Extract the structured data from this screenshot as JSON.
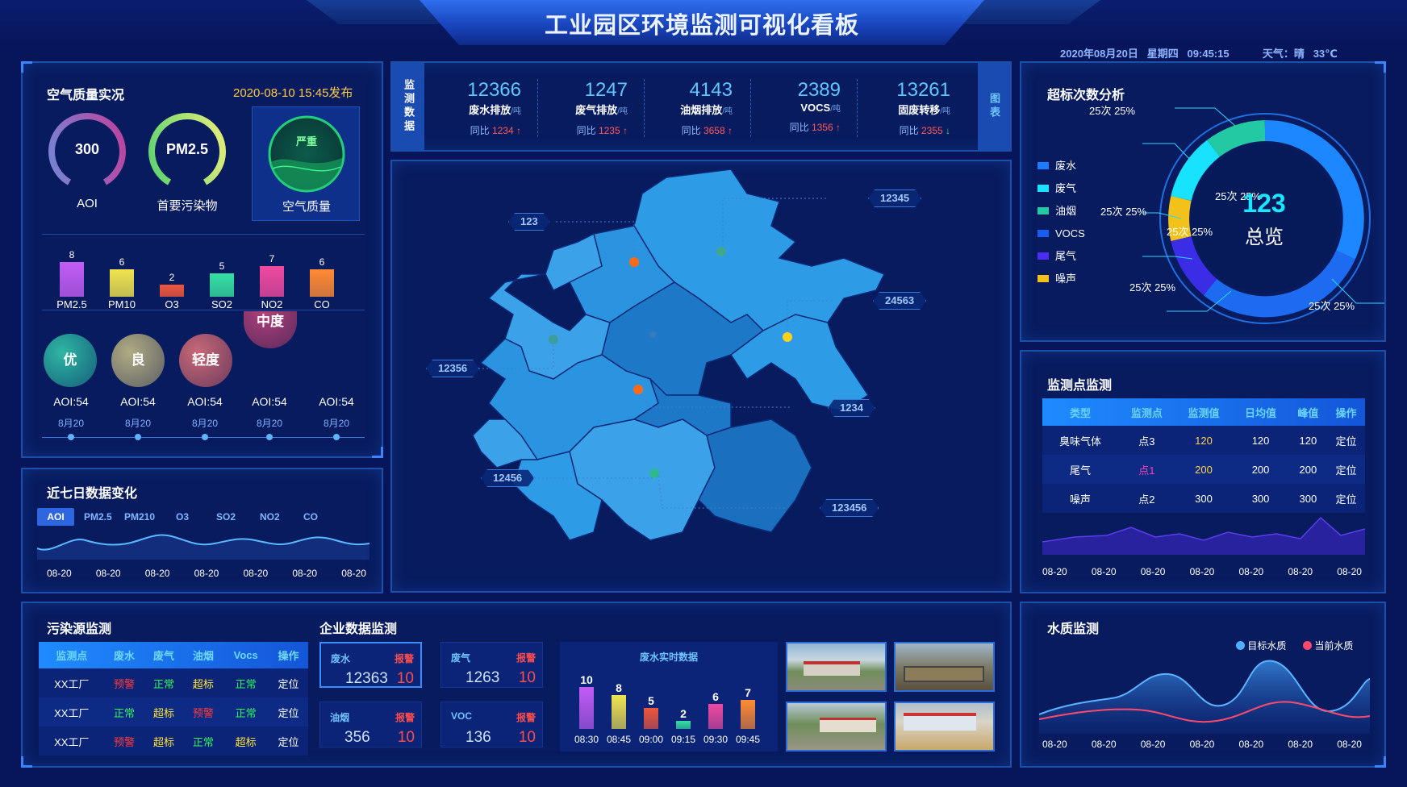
{
  "header": {
    "title": "工业园区环境监测可视化看板",
    "date": "2020年08月20日",
    "weekday": "星期四",
    "time": "09:45:15",
    "weather": "天气：晴",
    "temp": "33℃"
  },
  "air": {
    "title": "空气质量实况",
    "published": "2020-08-10  15:45发布",
    "aqi_value": "300",
    "aqi_label": "AOI",
    "primary_value": "PM2.5",
    "primary_label": "首要污染物",
    "quality_badge": "严重",
    "quality_label": "空气质量",
    "pollutants": [
      {
        "name": "PM2.5",
        "value": 8,
        "color": "#c35cf5"
      },
      {
        "name": "PM10",
        "value": 6,
        "color": "#f0e34e"
      },
      {
        "name": "O3",
        "value": 2,
        "color": "#f0573c"
      },
      {
        "name": "SO2",
        "value": 5,
        "color": "#35e0a2"
      },
      {
        "name": "NO2",
        "value": 7,
        "color": "#f04aa0"
      },
      {
        "name": "CO",
        "value": 6,
        "color": "#ff8a33"
      }
    ],
    "levels": [
      {
        "label": "优",
        "aoi": "AOI:54",
        "date": "8月20"
      },
      {
        "label": "良",
        "aoi": "AOI:54",
        "date": "8月20"
      },
      {
        "label": "轻度",
        "aoi": "AOI:54",
        "date": "8月20"
      },
      {
        "label": "中度",
        "aoi": "AOI:54",
        "date": "8月20"
      },
      {
        "aoi": "AOI:54",
        "date": "8月20"
      }
    ]
  },
  "week": {
    "title": "近七日数据变化",
    "tabs": [
      "AOI",
      "PM2.5",
      "PM210",
      "O3",
      "SO2",
      "NO2",
      "CO"
    ],
    "dates": [
      "08-20",
      "08-20",
      "08-20",
      "08-20",
      "08-20",
      "08-20",
      "08-20"
    ]
  },
  "kpi": {
    "side_label": "监测数据",
    "right_label": "图表",
    "items": [
      {
        "value": "12366",
        "name": "废水排放",
        "unit": "/吨",
        "cmp_label": "同比",
        "cmp_value": "1234",
        "dir": "up"
      },
      {
        "value": "1247",
        "name": "废气排放",
        "unit": "/吨",
        "cmp_label": "同比",
        "cmp_value": "1235",
        "dir": "up"
      },
      {
        "value": "4143",
        "name": "油烟排放",
        "unit": "/吨",
        "cmp_label": "同比",
        "cmp_value": "3658",
        "dir": "up"
      },
      {
        "value": "2389",
        "name": "VOCS",
        "unit": "/吨",
        "cmp_label": "同比",
        "cmp_value": "1356",
        "dir": "up"
      },
      {
        "value": "13261",
        "name": "固废转移",
        "unit": "/吨",
        "cmp_label": "同比",
        "cmp_value": "2355",
        "dir": "down"
      }
    ]
  },
  "map": {
    "tags": [
      "123",
      "12345",
      "24563",
      "12356",
      "1234",
      "12456",
      "123456"
    ]
  },
  "exceed": {
    "title": "超标次数分析",
    "center_value": "123",
    "center_label": "总览",
    "legend": [
      {
        "name": "废水",
        "color": "#1e7bff"
      },
      {
        "name": "废气",
        "color": "#18e3ff"
      },
      {
        "name": "油烟",
        "color": "#22c9a2"
      },
      {
        "name": "VOCS",
        "color": "#1a5cf0"
      },
      {
        "name": "尾气",
        "color": "#4a2df0"
      },
      {
        "name": "噪声",
        "color": "#f2c21b"
      }
    ],
    "slice_labels": [
      "25次 25%",
      "25次 25%",
      "25次 25%",
      "25次 25%",
      "25次 25%",
      "25次 25%"
    ]
  },
  "points": {
    "title": "监测点监测",
    "headers": [
      "类型",
      "监测点",
      "监测值",
      "日均值",
      "峰值",
      "操作"
    ],
    "rows": [
      {
        "type": "臭味气体",
        "point": "点3",
        "value": "120",
        "avg": "120",
        "peak": "120",
        "op": "定位",
        "vcolor": "#ffd24a",
        "pcolor": "#ffffff"
      },
      {
        "type": "尾气",
        "point": "点1",
        "value": "200",
        "avg": "200",
        "peak": "200",
        "op": "定位",
        "vcolor": "#ffd24a",
        "pcolor": "#ff3fb5"
      },
      {
        "type": "噪声",
        "point": "点2",
        "value": "300",
        "avg": "300",
        "peak": "300",
        "op": "定位",
        "vcolor": "#ffffff",
        "pcolor": "#ffffff"
      }
    ],
    "dates": [
      "08-20",
      "08-20",
      "08-20",
      "08-20",
      "08-20",
      "08-20",
      "08-20"
    ]
  },
  "source": {
    "title": "污染源监测",
    "headers": [
      "监测点",
      "废水",
      "废气",
      "油烟",
      "Vocs",
      "操作"
    ],
    "rows": [
      {
        "name": "XX工厂",
        "c": [
          "预警",
          "正常",
          "超标",
          "正常"
        ],
        "cls": [
          "st-red",
          "st-green",
          "st-yellow",
          "st-green"
        ],
        "op": "定位"
      },
      {
        "name": "XX工厂",
        "c": [
          "正常",
          "超标",
          "预警",
          "正常"
        ],
        "cls": [
          "st-green",
          "st-yellow",
          "st-red",
          "st-green"
        ],
        "op": "定位"
      },
      {
        "name": "XX工厂",
        "c": [
          "预警",
          "超标",
          "正常",
          "超标"
        ],
        "cls": [
          "st-red",
          "st-yellow",
          "st-green",
          "st-yellow"
        ],
        "op": "定位"
      }
    ]
  },
  "enterprise": {
    "title": "企业数据监测",
    "boxes": [
      {
        "name": "废水",
        "alarm": "报警",
        "value": "12363",
        "count": "10"
      },
      {
        "name": "废气",
        "alarm": "报警",
        "value": "1263",
        "count": "10"
      },
      {
        "name": "油烟",
        "alarm": "报警",
        "value": "356",
        "count": "10"
      },
      {
        "name": "VOC",
        "alarm": "报警",
        "value": "136",
        "count": "10"
      }
    ],
    "realtime_title": "废水实时数据",
    "realtime": [
      {
        "time": "08:30",
        "value": 10,
        "color": "#c35cf5"
      },
      {
        "time": "08:45",
        "value": 8,
        "color": "#f0e34e"
      },
      {
        "time": "09:00",
        "value": 5,
        "color": "#f0573c"
      },
      {
        "time": "09:15",
        "value": 2,
        "color": "#35e0a2"
      },
      {
        "time": "09:30",
        "value": 6,
        "color": "#f04aa0"
      },
      {
        "time": "09:45",
        "value": 7,
        "color": "#ff8a33"
      }
    ]
  },
  "water": {
    "title": "水质监测",
    "legend": [
      {
        "name": "目标水质",
        "color": "#4fb0ff"
      },
      {
        "name": "当前水质",
        "color": "#ff4a6e"
      }
    ],
    "dates": [
      "08-20",
      "08-20",
      "08-20",
      "08-20",
      "08-20",
      "08-20",
      "08-20"
    ]
  }
}
